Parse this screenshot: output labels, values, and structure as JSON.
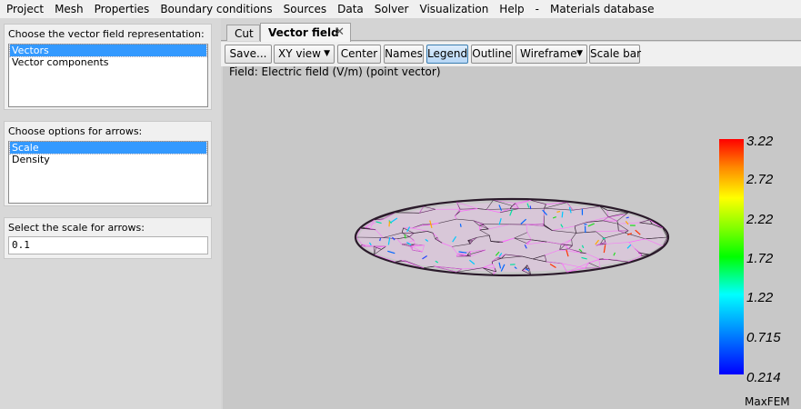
{
  "menu": [
    "Project",
    "Mesh",
    "Properties",
    "Boundary conditions",
    "Sources",
    "Data",
    "Solver",
    "Visualization",
    "Help",
    "-",
    "Materials database"
  ],
  "representation": {
    "title": "Choose the vector field representation:",
    "items": [
      {
        "label": "Vectors",
        "selected": true
      },
      {
        "label": "Vector components",
        "selected": false
      }
    ]
  },
  "arrows": {
    "title": "Choose options for arrows:",
    "items": [
      {
        "label": "Scale",
        "selected": true
      },
      {
        "label": "Density",
        "selected": false
      }
    ]
  },
  "scale": {
    "title": "Select the scale for arrows:",
    "value": "0.1"
  },
  "tabs": {
    "cut": "Cut",
    "vector_field": "Vector field",
    "close_glyph": "✕"
  },
  "toolbar": {
    "save": "Save...",
    "view": "XY view",
    "center": "Center",
    "names": "Names",
    "legend": "Legend",
    "outline": "Outline",
    "render_mode": "Wireframe",
    "scale_bar": "Scale bar",
    "active": "legend"
  },
  "viewport": {
    "field_label": "Field: Electric field (V/m) (point vector)",
    "background": "#c8c8c8",
    "mesh_color": "#2a1a2a",
    "mesh_highlight": "#ff66ff",
    "legend_values": [
      "3.22",
      "2.72",
      "2.22",
      "1.72",
      "1.22",
      "0.715",
      "0.214"
    ],
    "brand": "MaxFEM"
  }
}
